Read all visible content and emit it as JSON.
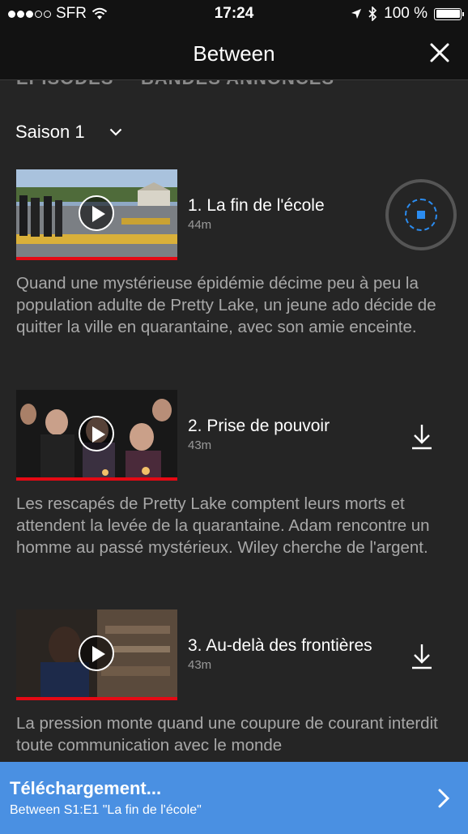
{
  "status_bar": {
    "carrier": "SFR",
    "time": "17:24",
    "battery": "100 %"
  },
  "header": {
    "title": "Between",
    "close_icon": "close-icon"
  },
  "tabs": [
    {
      "label": "ÉPISODES"
    },
    {
      "label": "BANDES ANNONCES"
    }
  ],
  "season_selector": {
    "label": "Saison 1",
    "icon": "chevron-down-icon"
  },
  "episodes": [
    {
      "title": "1. La fin de l'école",
      "duration": "44m",
      "description": "Quand une mystérieuse épidémie décime peu à peu la population adulte de Pretty Lake, un jeune ado décide de quitter la ville en quarantaine, avec son amie enceinte.",
      "download_state": "downloading"
    },
    {
      "title": "2. Prise de pouvoir",
      "duration": "43m",
      "description": "Les rescapés de Pretty Lake comptent leurs morts et attendent la levée de la quarantaine. Adam rencontre un homme au passé mystérieux. Wiley cherche de l'argent.",
      "download_state": "available"
    },
    {
      "title": "3. Au-delà des frontières",
      "duration": "43m",
      "description": "La pression monte quand une coupure de courant interdit toute communication avec le monde",
      "download_state": "available"
    }
  ],
  "download_bar": {
    "title": "Téléchargement...",
    "subtitle": "Between S1:E1 \"La fin de l'école\""
  },
  "colors": {
    "accent_blue": "#4a90e2",
    "progress_red": "#e50914",
    "background": "#252525"
  }
}
